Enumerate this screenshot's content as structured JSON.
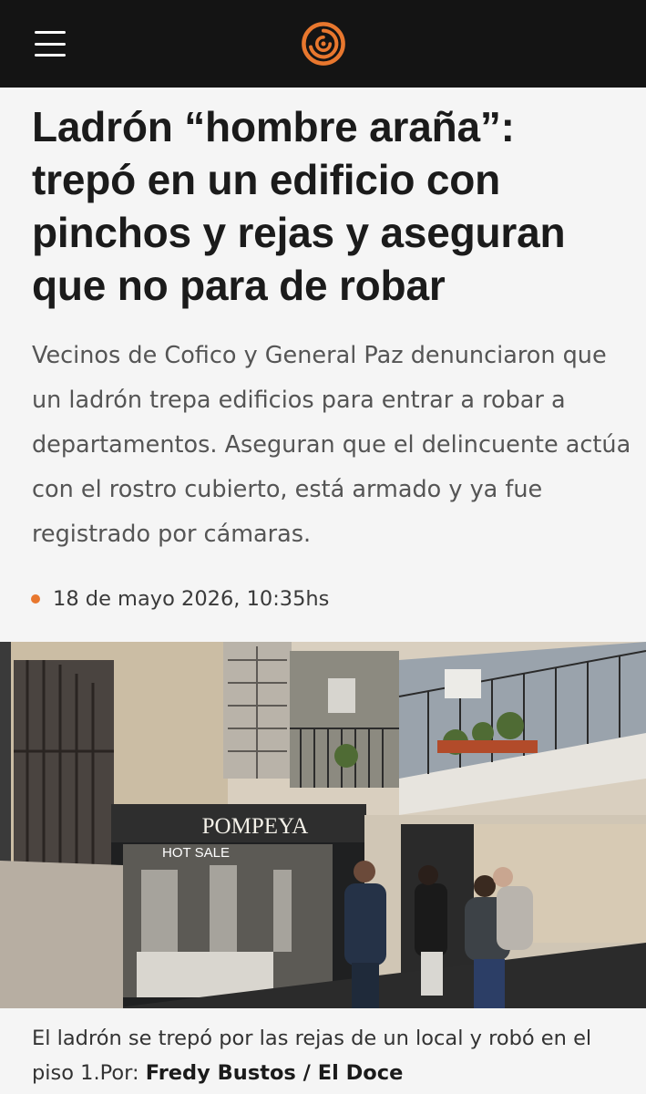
{
  "header": {
    "logo_name": "el-doce-logo",
    "menu_icon": "hamburger-menu-icon",
    "accent_color": "#e8772e"
  },
  "article": {
    "headline": "Ladrón “hombre araña”: trepó en un edificio con pinchos y rejas y aseguran que no para de robar",
    "summary": "Vecinos de Cofico y General Paz denunciaron que un ladrón trepa edificios para entrar a robar a departamentos. Aseguran que el delincuente actúa con el rostro cubierto, está armado y ya fue registrado por cámaras.",
    "date": "18 de mayo 2026, 10:35hs"
  },
  "photo": {
    "storefront_sign": "POMPEYA",
    "window_text": "HOT SALE"
  },
  "caption": {
    "text": "El ladrón se trepó por las rejas de un local y robó en el piso 1.Por: ",
    "credit": "Fredy Bustos / El Doce"
  }
}
